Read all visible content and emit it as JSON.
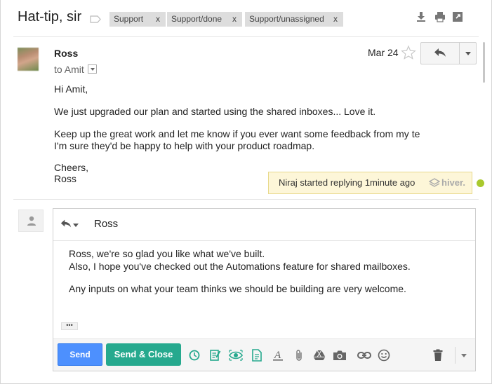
{
  "thread": {
    "subject": "Hat-tip, sir",
    "labels": [
      {
        "text": "Support",
        "remove": "x"
      },
      {
        "text": "Support/done",
        "remove": "x"
      },
      {
        "text": "Support/unassigned",
        "remove": "x"
      }
    ],
    "actions": [
      "download-icon",
      "print-icon",
      "new-window-icon"
    ]
  },
  "message": {
    "sender": "Ross",
    "to": "to Amit",
    "date": "Mar 24",
    "body": [
      "Hi Amit,",
      "We just upgraded our plan and started using the shared inboxes... Love it.",
      "Keep up the great work and let me know if you ever want some feedback from my te",
      "I'm sure they'd be happy to help with your product roadmap.",
      "Cheers,",
      "Ross"
    ]
  },
  "notice": {
    "text": "Niraj started replying 1minute ago",
    "brand": "hiver.",
    "dot_color": "#a9c92d"
  },
  "compose": {
    "to": "Ross",
    "body": [
      "Ross, we're so glad you like what we've built.",
      "Also, I hope you've checked out the Automations feature for shared mailboxes.",
      "Any inputs on what your team thinks we should be building are very welcome."
    ],
    "ellipsis": "•••",
    "send_label": "Send",
    "send_close_label": "Send & Close",
    "send_color": "#4d90fe",
    "send_close_color": "#26a98e",
    "hiver_tool_color": "#26a98e",
    "tools": [
      "clock-icon",
      "notes-icon",
      "eye-icon",
      "template-icon",
      "format-text-icon",
      "attach-icon",
      "drive-icon",
      "camera-icon",
      "link-icon",
      "emoji-icon",
      "trash-icon",
      "more-options-icon"
    ]
  }
}
